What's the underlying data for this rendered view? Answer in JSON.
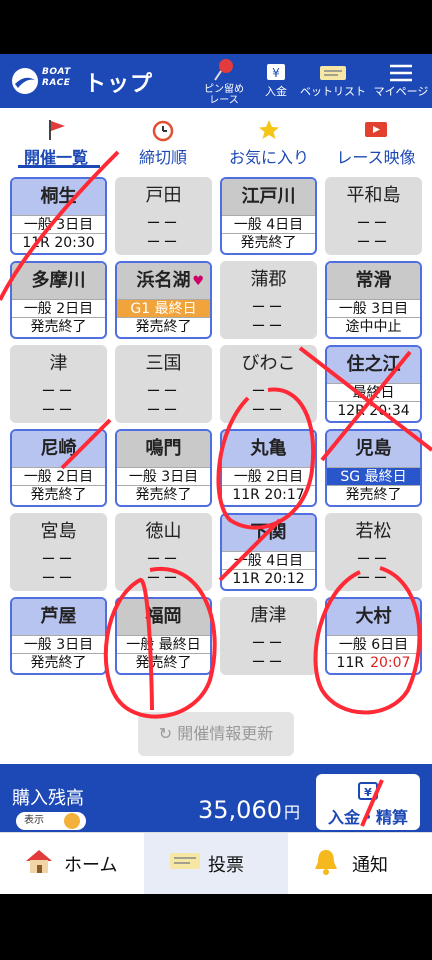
{
  "header": {
    "logo_line1": "BOAT",
    "logo_line2": "RACE",
    "title": "トップ",
    "pin_label": "ピン留め\nレース",
    "deposit_label": "入金",
    "betlist_label": "ベットリスト",
    "mypage_label": "マイページ"
  },
  "tabs": [
    {
      "label": "開催一覧"
    },
    {
      "label": "締切順"
    },
    {
      "label": "お気に入り"
    },
    {
      "label": "レース映像"
    }
  ],
  "venues": [
    {
      "name": "桐生",
      "l1": "一般 3日目",
      "l2": "11R 20:30"
    },
    {
      "name": "戸田",
      "l1": "ーー",
      "l2": "ーー"
    },
    {
      "name": "江戸川",
      "l1": "一般 4日目",
      "l2": "発売終了"
    },
    {
      "name": "平和島",
      "l1": "ーー",
      "l2": "ーー"
    },
    {
      "name": "多摩川",
      "l1": "一般 2日目",
      "l2": "発売終了"
    },
    {
      "name": "浜名湖",
      "l1": "G1 最終日",
      "l2": "発売終了"
    },
    {
      "name": "蒲郡",
      "l1": "ーー",
      "l2": "ーー"
    },
    {
      "name": "常滑",
      "l1": "一般 3日目",
      "l2": "途中中止"
    },
    {
      "name": "津",
      "l1": "ーー",
      "l2": "ーー"
    },
    {
      "name": "三国",
      "l1": "ーー",
      "l2": "ーー"
    },
    {
      "name": "びわこ",
      "l1": "ーー",
      "l2": "ーー"
    },
    {
      "name": "住之江",
      "l1": "最終日",
      "l2": "12R 20:34"
    },
    {
      "name": "尼崎",
      "l1": "一般 2日目",
      "l2": "発売終了"
    },
    {
      "name": "鳴門",
      "l1": "一般 3日目",
      "l2": "発売終了"
    },
    {
      "name": "丸亀",
      "l1": "一般 2日目",
      "l2": "11R 20:17"
    },
    {
      "name": "児島",
      "l1": "SG 最終日",
      "l2": "発売終了"
    },
    {
      "name": "宮島",
      "l1": "ーー",
      "l2": "ーー"
    },
    {
      "name": "徳山",
      "l1": "ーー",
      "l2": "ーー"
    },
    {
      "name": "下関",
      "l1": "一般 4日目",
      "l2": "11R 20:12"
    },
    {
      "name": "若松",
      "l1": "ーー",
      "l2": "ーー"
    },
    {
      "name": "芦屋",
      "l1": "一般 3日目",
      "l2": "発売終了"
    },
    {
      "name": "福岡",
      "l1": "一般 最終日",
      "l2": "発売終了"
    },
    {
      "name": "唐津",
      "l1": "ーー",
      "l2": "ーー"
    },
    {
      "name": "大村",
      "l1": "一般 6日目",
      "l2": "11R",
      "l2b": "20:07"
    }
  ],
  "refresh_label": "開催情報更新",
  "balance": {
    "label": "購入残高",
    "toggle_label": "表示",
    "amount": "35,060",
    "unit": "円",
    "deposit_button": "入金・精算"
  },
  "bottom_nav": [
    {
      "label": "ホーム"
    },
    {
      "label": "投票"
    },
    {
      "label": "通知"
    }
  ],
  "colors": {
    "brand": "#1d49b6",
    "card_open_head": "#b8c4f0",
    "g1_badge": "#f1a33c",
    "sg_badge": "#2a56cc",
    "scribble": "#ff2a36"
  }
}
